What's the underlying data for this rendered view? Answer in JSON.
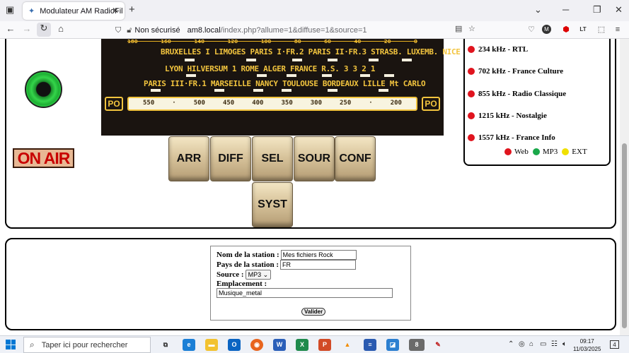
{
  "browser": {
    "tab_title": "Modulateur AM RadioFil",
    "security_label": "Non sécurisé",
    "url_host": "am8.local",
    "url_path": "/index.php?allume=1&diffuse=1&source=1"
  },
  "dial": {
    "scale_ticks": [
      "180",
      "160",
      "140",
      "120",
      "100",
      "80",
      "60",
      "40",
      "20",
      "0"
    ],
    "row1": "BRUXELLES I    LIMOGES PARIS I·FR.2 PARIS II·FR.3 STRASB. LUXEMB.  NICE",
    "row2": "LYON     HILVERSUM 1   ROME   ALGER  FRANCE R.S. 3   3  2  1",
    "row3": "PARIS III·FR.1   MARSEILLE    NANCY TOULOUSE BORDEAUX   LILLE  Mt CARLO",
    "band_left": "PO",
    "band_right": "PO",
    "freq_ticks": [
      "550",
      "·",
      "500",
      "450",
      "400",
      "350",
      "300",
      "250",
      "·",
      "200"
    ]
  },
  "onair_label": "ON AIR",
  "buttons": {
    "arr": "ARR",
    "diff": "DIFF",
    "sel": "SEL",
    "sour": "SOUR",
    "conf": "CONF",
    "syst": "SYST"
  },
  "stations": [
    {
      "label": "234 kHz - RTL",
      "color": "#e0141e"
    },
    {
      "label": "702 kHz - France Culture",
      "color": "#e0141e"
    },
    {
      "label": "855 kHz - Radio Classique",
      "color": "#e0141e"
    },
    {
      "label": "1215 kHz - Nostalgie",
      "color": "#e0141e"
    },
    {
      "label": "1557 kHz - France Info",
      "color": "#e0141e"
    }
  ],
  "legend": [
    {
      "label": "Web",
      "color": "#e0141e"
    },
    {
      "label": "MP3",
      "color": "#1aa84a"
    },
    {
      "label": "EXT",
      "color": "#f0e000"
    }
  ],
  "form": {
    "station_name_label": "Nom de la station :",
    "station_name_value": "Mes fichiers Rock",
    "country_label": "Pays de la station :",
    "country_value": "FR",
    "source_label": "Source :",
    "source_value": "MP3",
    "location_label": "Emplacement :",
    "location_value": "Musique_metal",
    "submit_label": "Valider"
  },
  "taskbar": {
    "search_placeholder": "Taper ici pour rechercher",
    "time": "09:17",
    "date": "11/03/2025",
    "notification_count": "4"
  }
}
